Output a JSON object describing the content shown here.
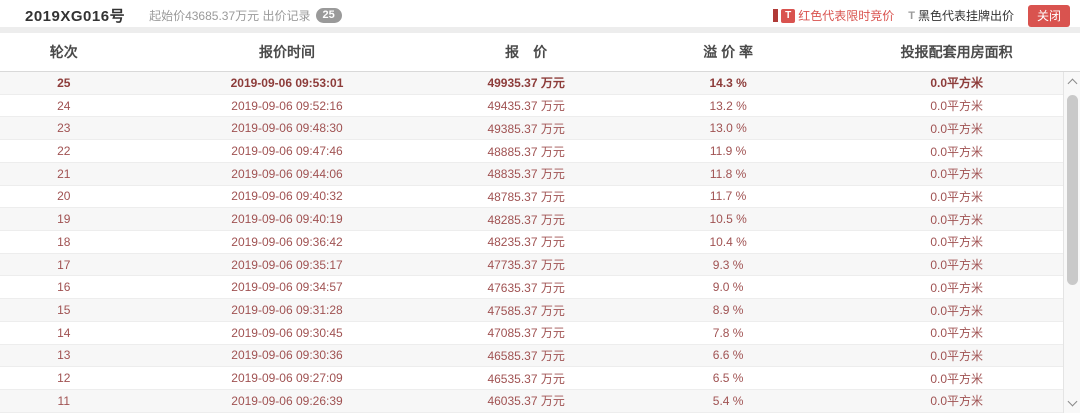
{
  "header": {
    "title": "2019XG016号",
    "start_price_label": "起始价43685.37万元",
    "bid_record_label": "出价记录",
    "bid_count": "25",
    "legend": {
      "red_icon": "T",
      "red_label": "红色代表限时竞价",
      "black_icon": "T",
      "black_label": "黑色代表挂牌出价"
    },
    "close_button": "关闭"
  },
  "colors": {
    "accent": "#d9534f",
    "row_text": "#a05252",
    "stripe": "#f7f7f7"
  },
  "table": {
    "columns": [
      "轮次",
      "报价时间",
      "报　价",
      "溢 价 率",
      "投报配套用房面积"
    ],
    "rows": [
      {
        "round": "25",
        "time": "2019-09-06 09:53:01",
        "price": "49935.37 万元",
        "premium": "14.3 %",
        "area": "0.0平方米",
        "current": true
      },
      {
        "round": "24",
        "time": "2019-09-06 09:52:16",
        "price": "49435.37 万元",
        "premium": "13.2 %",
        "area": "0.0平方米",
        "current": false
      },
      {
        "round": "23",
        "time": "2019-09-06 09:48:30",
        "price": "49385.37 万元",
        "premium": "13.0 %",
        "area": "0.0平方米",
        "current": false
      },
      {
        "round": "22",
        "time": "2019-09-06 09:47:46",
        "price": "48885.37 万元",
        "premium": "11.9 %",
        "area": "0.0平方米",
        "current": false
      },
      {
        "round": "21",
        "time": "2019-09-06 09:44:06",
        "price": "48835.37 万元",
        "premium": "11.8 %",
        "area": "0.0平方米",
        "current": false
      },
      {
        "round": "20",
        "time": "2019-09-06 09:40:32",
        "price": "48785.37 万元",
        "premium": "11.7 %",
        "area": "0.0平方米",
        "current": false
      },
      {
        "round": "19",
        "time": "2019-09-06 09:40:19",
        "price": "48285.37 万元",
        "premium": "10.5 %",
        "area": "0.0平方米",
        "current": false
      },
      {
        "round": "18",
        "time": "2019-09-06 09:36:42",
        "price": "48235.37 万元",
        "premium": "10.4 %",
        "area": "0.0平方米",
        "current": false
      },
      {
        "round": "17",
        "time": "2019-09-06 09:35:17",
        "price": "47735.37 万元",
        "premium": "9.3 %",
        "area": "0.0平方米",
        "current": false
      },
      {
        "round": "16",
        "time": "2019-09-06 09:34:57",
        "price": "47635.37 万元",
        "premium": "9.0 %",
        "area": "0.0平方米",
        "current": false
      },
      {
        "round": "15",
        "time": "2019-09-06 09:31:28",
        "price": "47585.37 万元",
        "premium": "8.9 %",
        "area": "0.0平方米",
        "current": false
      },
      {
        "round": "14",
        "time": "2019-09-06 09:30:45",
        "price": "47085.37 万元",
        "premium": "7.8 %",
        "area": "0.0平方米",
        "current": false
      },
      {
        "round": "13",
        "time": "2019-09-06 09:30:36",
        "price": "46585.37 万元",
        "premium": "6.6 %",
        "area": "0.0平方米",
        "current": false
      },
      {
        "round": "12",
        "time": "2019-09-06 09:27:09",
        "price": "46535.37 万元",
        "premium": "6.5 %",
        "area": "0.0平方米",
        "current": false
      },
      {
        "round": "11",
        "time": "2019-09-06 09:26:39",
        "price": "46035.37 万元",
        "premium": "5.4 %",
        "area": "0.0平方米",
        "current": false
      }
    ]
  }
}
